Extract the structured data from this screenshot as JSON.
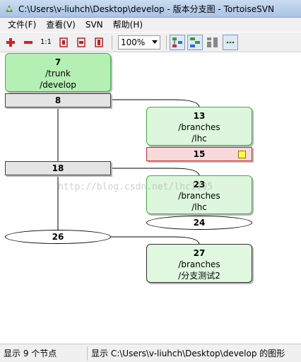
{
  "window": {
    "title": "C:\\Users\\v-liuhch\\Desktop\\develop - 版本分支图 - TortoiseSVN"
  },
  "menu": {
    "items": [
      "文件(F)",
      "查看(V)",
      "SVN",
      "帮助(H)"
    ]
  },
  "toolbar": {
    "zoom": "100%",
    "one_to_one_label": "1:1"
  },
  "graph": {
    "nodes": [
      {
        "rev": "7",
        "path1": "/trunk",
        "path2": "/develop"
      },
      {
        "rev": "8"
      },
      {
        "rev": "13",
        "path1": "/branches",
        "path2": "/lhc"
      },
      {
        "rev": "15"
      },
      {
        "rev": "18"
      },
      {
        "rev": "23",
        "path1": "/branches",
        "path2": "/lhc"
      },
      {
        "rev": "24"
      },
      {
        "rev": "26"
      },
      {
        "rev": "27",
        "path1": "/branches",
        "path2": "/分支测试2"
      }
    ],
    "watermark": "http://blog.csdn.net/lhc1105"
  },
  "status": {
    "node_count": "显示 9 个节点",
    "path": "显示 C:\\Users\\v-liuhch\\Desktop\\develop 的图形"
  },
  "colors": {
    "green_border": "#40b040",
    "green_fill": "#ddf6dd",
    "deleted_fill": "#f8dada"
  }
}
